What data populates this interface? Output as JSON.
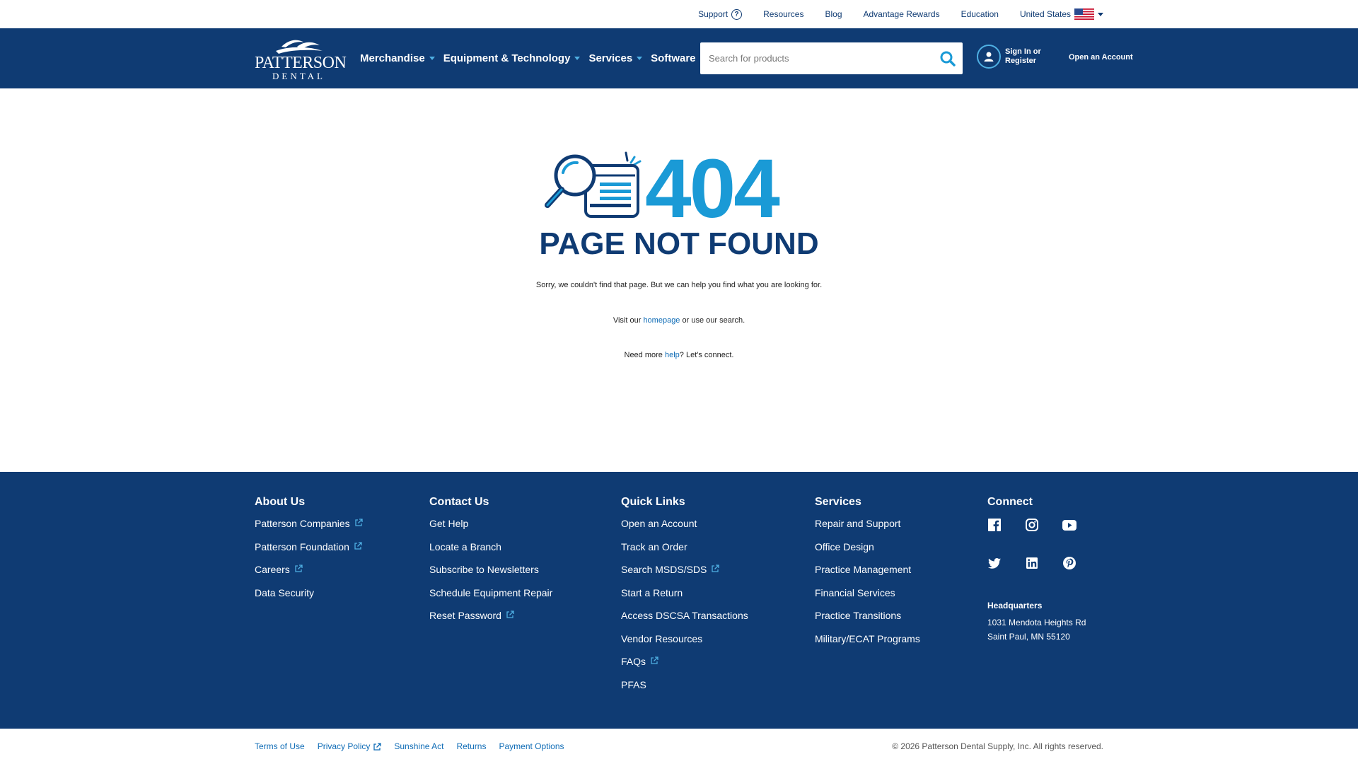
{
  "utility": {
    "support": "Support",
    "resources": "Resources",
    "blog": "Blog",
    "advantage": "Advantage Rewards",
    "education": "Education",
    "country": "United States"
  },
  "header": {
    "logo_line1": "PATTERSON",
    "logo_line2": "DENTAL",
    "nav": {
      "merch": "Merchandise",
      "equip": "Equipment & Technology",
      "services": "Services",
      "software": "Software"
    },
    "search_placeholder": "Search for products",
    "signin_line1": "Sign In or",
    "signin_line2": "Register",
    "open_account": "Open an Account"
  },
  "error": {
    "code": "404",
    "title": "PAGE NOT FOUND",
    "sorry": "Sorry, we couldn't find that page. But we can help you find what you are looking for.",
    "visit_pre": "Visit our ",
    "visit_link": "homepage",
    "visit_post": " or use our search.",
    "help_pre": "Need more ",
    "help_link": "help",
    "help_post": "? Let's connect."
  },
  "footer": {
    "about": {
      "title": "About Us",
      "items": [
        "Patterson Companies",
        "Patterson Foundation",
        "Careers",
        "Data Security"
      ]
    },
    "contact": {
      "title": "Contact Us",
      "items": [
        "Get Help",
        "Locate a Branch",
        "Subscribe to Newsletters",
        "Schedule Equipment Repair",
        "Reset Password"
      ]
    },
    "quick": {
      "title": "Quick Links",
      "items": [
        "Open an Account",
        "Track an Order",
        "Search MSDS/SDS",
        "Start a Return",
        "Access DSCSA Transactions",
        "Vendor Resources",
        "FAQs",
        "PFAS"
      ]
    },
    "services": {
      "title": "Services",
      "items": [
        "Repair and Support",
        "Office Design",
        "Practice Management",
        "Financial Services",
        "Practice Transitions",
        "Military/ECAT Programs"
      ]
    },
    "connect": {
      "title": "Connect",
      "social": [
        "facebook-icon",
        "instagram-icon",
        "youtube-icon",
        "twitter-icon",
        "linkedin-icon",
        "pinterest-icon"
      ],
      "hq_title": "Headquarters",
      "hq_line1": "1031 Mendota Heights Rd",
      "hq_line2": "Saint Paul, MN 55120"
    }
  },
  "bottom": {
    "terms": "Terms of Use",
    "privacy": "Privacy Policy",
    "sunshine": "Sunshine Act",
    "returns": "Returns",
    "payment": "Payment Options",
    "copyright": "© 2026 Patterson Dental Supply, Inc. All rights reserved."
  },
  "colors": {
    "navy": "#0f3b73",
    "accent_blue": "#1a9ad6",
    "link_blue": "#0f6cb6"
  }
}
